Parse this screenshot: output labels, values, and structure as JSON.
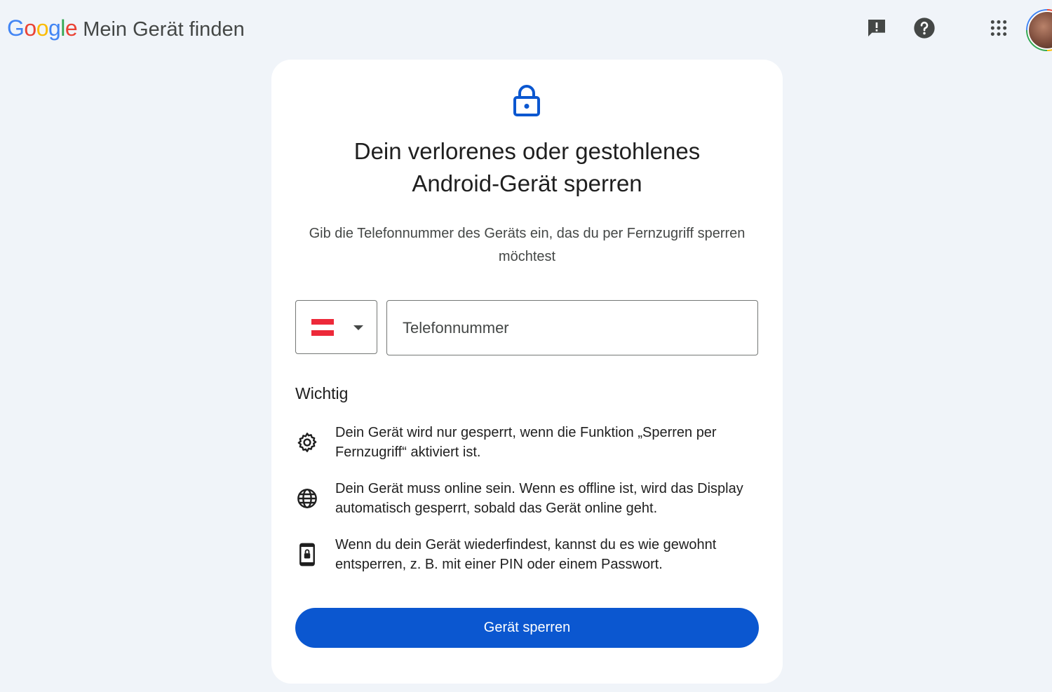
{
  "header": {
    "logo_letters": [
      "G",
      "o",
      "o",
      "g",
      "l",
      "e"
    ],
    "product_name": "Mein Gerät finden",
    "icons": [
      "feedback-icon",
      "help-icon",
      "apps-grid-icon"
    ],
    "avatar": "account-avatar"
  },
  "card": {
    "title_line1": "Dein verlorenes oder gestohlenes",
    "title_line2": "Android-Gerät sperren",
    "subtitle": "Gib die Telefonnummer des Geräts ein, das du per Fernzugriff sperren möchtest",
    "country_select": {
      "selected_flag": "austria-flag",
      "flag_colors": [
        "#ed2939",
        "#ffffff",
        "#ed2939"
      ]
    },
    "phone_placeholder": "Telefonnummer",
    "phone_value": "",
    "important_heading": "Wichtig",
    "info_items": [
      {
        "icon": "gear-icon",
        "text": "Dein Gerät wird nur gesperrt, wenn die Funktion „Sperren per Fernzugriff“ aktiviert ist."
      },
      {
        "icon": "globe-icon",
        "text": "Dein Gerät muss online sein. Wenn es offline ist, wird das Display automatisch gesperrt, sobald das Gerät online geht."
      },
      {
        "icon": "phone-lock-icon",
        "text": "Wenn du dein Gerät wiederfindest, kannst du es wie gewohnt entsperren, z. B. mit einer PIN oder einem Passwort."
      }
    ],
    "lock_button_label": "Gerät sperren"
  },
  "colors": {
    "accent": "#0b57d0",
    "background": "#f0f4f9",
    "logo": [
      "#4285f4",
      "#ea4335",
      "#fbbc05",
      "#4285f4",
      "#34a853",
      "#ea4335"
    ]
  }
}
